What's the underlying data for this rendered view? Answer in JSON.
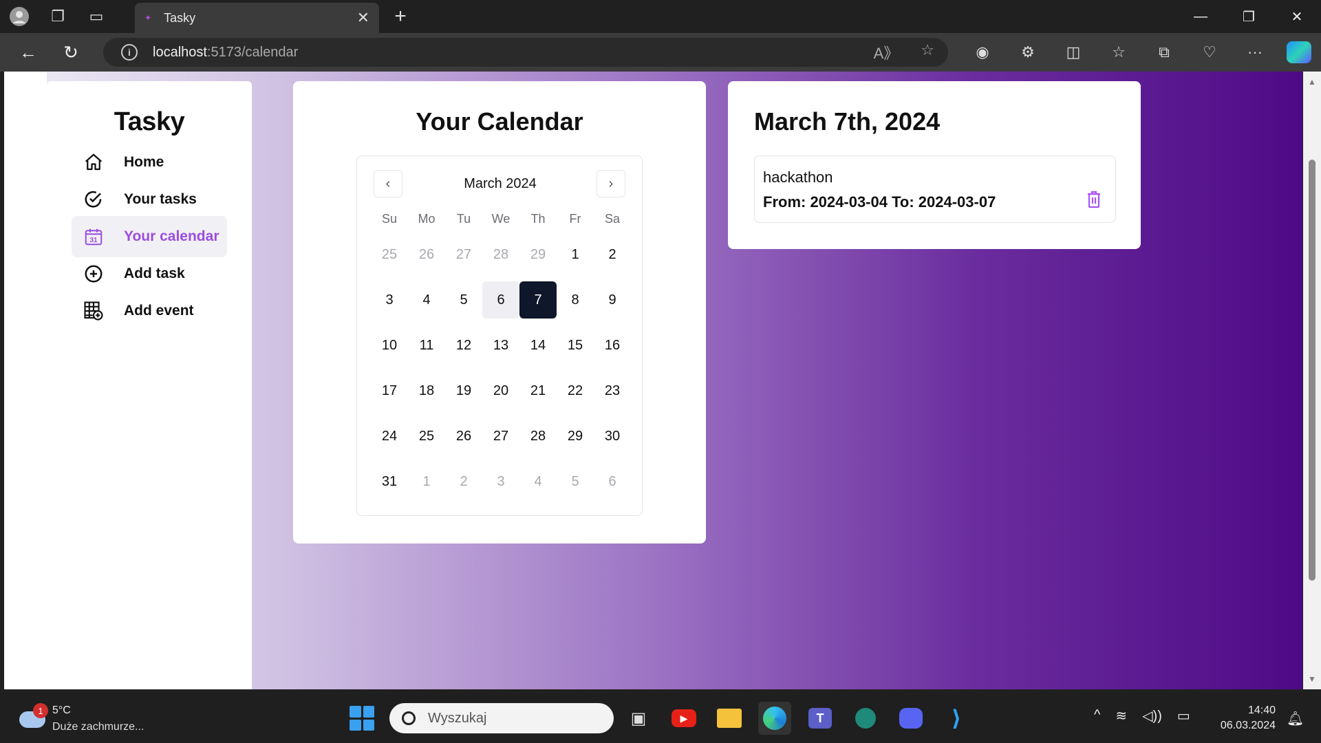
{
  "browser": {
    "tab_title": "Tasky",
    "address_host": "localhost",
    "address_path": ":5173/calendar"
  },
  "sidebar": {
    "brand": "Tasky",
    "items": [
      {
        "label": "Home",
        "icon": "home-icon"
      },
      {
        "label": "Your tasks",
        "icon": "check-circle-icon"
      },
      {
        "label": "Your calendar",
        "icon": "calendar-icon",
        "active": true
      },
      {
        "label": "Add task",
        "icon": "plus-circle-icon"
      },
      {
        "label": "Add event",
        "icon": "table-add-icon"
      }
    ],
    "accent_color": "#9b4de0"
  },
  "calendar": {
    "title": "Your Calendar",
    "month_label": "March 2024",
    "weekdays": [
      "Su",
      "Mo",
      "Tu",
      "We",
      "Th",
      "Fr",
      "Sa"
    ],
    "weeks": [
      [
        "25",
        "26",
        "27",
        "28",
        "29",
        "1",
        "2"
      ],
      [
        "3",
        "4",
        "5",
        "6",
        "7",
        "8",
        "9"
      ],
      [
        "10",
        "11",
        "12",
        "13",
        "14",
        "15",
        "16"
      ],
      [
        "17",
        "18",
        "19",
        "20",
        "21",
        "22",
        "23"
      ],
      [
        "24",
        "25",
        "26",
        "27",
        "28",
        "29",
        "30"
      ],
      [
        "31",
        "1",
        "2",
        "3",
        "4",
        "5",
        "6"
      ]
    ],
    "today_day": "6",
    "selected_day": "7"
  },
  "events": {
    "date_title": "March 7th, 2024",
    "items": [
      {
        "name": "hackathon",
        "range": "From: 2024-03-04 To: 2024-03-07"
      }
    ]
  },
  "taskbar": {
    "weather_temp": "5°C",
    "weather_desc": "Duże zachmurze...",
    "weather_badge": "1",
    "search_placeholder": "Wyszukaj",
    "time": "14:40",
    "date": "06.03.2024"
  }
}
